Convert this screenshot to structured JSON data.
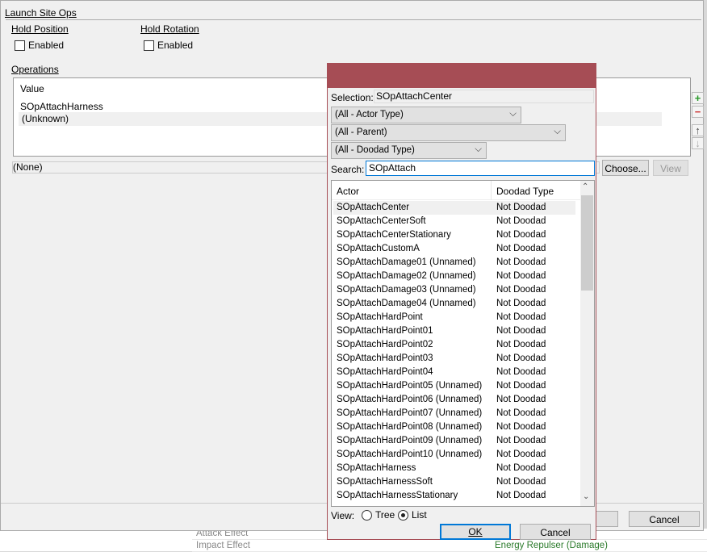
{
  "background": {
    "rows": [
      {
        "label": "Attack Effect",
        "value": ""
      },
      {
        "label": "Impact Effect",
        "value": "Energy Repulser (Damage)"
      }
    ]
  },
  "main": {
    "section_title": "Launch Site Ops",
    "hold_position": {
      "title": "Hold Position",
      "checkbox": "Enabled",
      "checked": false
    },
    "hold_rotation": {
      "title": "Hold Rotation",
      "checkbox": "Enabled",
      "checked": false
    },
    "operations_label": "Operations",
    "ops_header": "Value",
    "ops_rows": [
      "SOpAttachHarness",
      "(Unknown)"
    ],
    "none_field": "(None)",
    "choose_label": "Choose...",
    "view_label": "View",
    "cancel_label": "Cancel"
  },
  "dialog": {
    "selection_label": "Selection:",
    "selection_value": "SOpAttachCenter",
    "filters": [
      "(All - Actor Type)",
      "(All - Parent)",
      "(All - Doodad Type)"
    ],
    "search_label": "Search:",
    "search_value": "SOpAttach",
    "columns": [
      "Actor",
      "Doodad Type"
    ],
    "rows": [
      [
        "SOpAttachCenter",
        "Not Doodad"
      ],
      [
        "SOpAttachCenterSoft",
        "Not Doodad"
      ],
      [
        "SOpAttachCenterStationary",
        "Not Doodad"
      ],
      [
        "SOpAttachCustomA",
        "Not Doodad"
      ],
      [
        "SOpAttachDamage01 (Unnamed)",
        "Not Doodad"
      ],
      [
        "SOpAttachDamage02 (Unnamed)",
        "Not Doodad"
      ],
      [
        "SOpAttachDamage03 (Unnamed)",
        "Not Doodad"
      ],
      [
        "SOpAttachDamage04 (Unnamed)",
        "Not Doodad"
      ],
      [
        "SOpAttachHardPoint",
        "Not Doodad"
      ],
      [
        "SOpAttachHardPoint01",
        "Not Doodad"
      ],
      [
        "SOpAttachHardPoint02",
        "Not Doodad"
      ],
      [
        "SOpAttachHardPoint03",
        "Not Doodad"
      ],
      [
        "SOpAttachHardPoint04",
        "Not Doodad"
      ],
      [
        "SOpAttachHardPoint05 (Unnamed)",
        "Not Doodad"
      ],
      [
        "SOpAttachHardPoint06 (Unnamed)",
        "Not Doodad"
      ],
      [
        "SOpAttachHardPoint07 (Unnamed)",
        "Not Doodad"
      ],
      [
        "SOpAttachHardPoint08 (Unnamed)",
        "Not Doodad"
      ],
      [
        "SOpAttachHardPoint09 (Unnamed)",
        "Not Doodad"
      ],
      [
        "SOpAttachHardPoint10 (Unnamed)",
        "Not Doodad"
      ],
      [
        "SOpAttachHarness",
        "Not Doodad"
      ],
      [
        "SOpAttachHarnessSoft",
        "Not Doodad"
      ],
      [
        "SOpAttachHarnessStationary",
        "Not Doodad"
      ]
    ],
    "view_label": "View:",
    "view_tree": "Tree",
    "view_list": "List",
    "view_selected": "List",
    "ok_label": "OK",
    "cancel_label": "Cancel"
  },
  "colors": {
    "title_bar": "#a64d55",
    "focus": "#0078d7"
  }
}
